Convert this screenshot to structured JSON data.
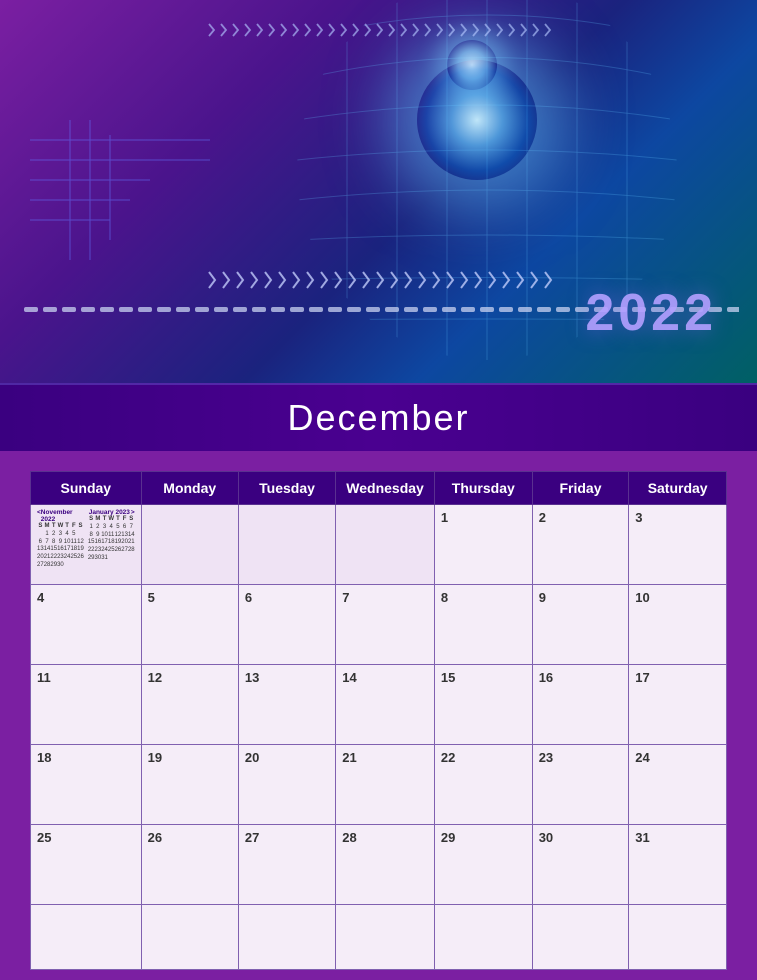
{
  "header": {
    "year": "2022",
    "month": "December",
    "background": {
      "leftColor": "#7b1fa2",
      "rightColor": "#006064"
    }
  },
  "calendar": {
    "days": [
      "Sunday",
      "Monday",
      "Tuesday",
      "Wednesday",
      "Thursday",
      "Friday",
      "Saturday"
    ],
    "weeks": [
      [
        null,
        null,
        null,
        null,
        "1",
        "2",
        "3"
      ],
      [
        "4",
        "5",
        "6",
        "7",
        "8",
        "9",
        "10"
      ],
      [
        "11",
        "12",
        "13",
        "14",
        "15",
        "16",
        "17"
      ],
      [
        "18",
        "19",
        "20",
        "21",
        "22",
        "23",
        "24"
      ],
      [
        "25",
        "26",
        "27",
        "28",
        "29",
        "30",
        "31"
      ],
      [
        null,
        null,
        null,
        null,
        null,
        null,
        null
      ]
    ],
    "mini_calendars": {
      "nov": {
        "title": "November 2022",
        "nav_prev": "<",
        "headers": [
          "S",
          "M",
          "T",
          "W",
          "T",
          "F",
          "S"
        ],
        "days": [
          "",
          "1",
          "2",
          "3",
          "4",
          "5",
          "",
          "6",
          "7",
          "8",
          "9",
          "10",
          "11",
          "12",
          "13",
          "14",
          "15",
          "16",
          "17",
          "18",
          "19",
          "20",
          "21",
          "22",
          "23",
          "24",
          "25",
          "26",
          "27",
          "28",
          "29",
          "30",
          ""
        ]
      },
      "jan": {
        "title": "January 2023",
        "nav_next": ">",
        "headers": [
          "S",
          "M",
          "T",
          "W",
          "T",
          "F",
          "S"
        ],
        "days": [
          "1",
          "2",
          "3",
          "4",
          "5",
          "6",
          "7",
          "8",
          "9",
          "10",
          "11",
          "12",
          "13",
          "14",
          "15",
          "16",
          "17",
          "18",
          "19",
          "20",
          "21",
          "22",
          "23",
          "24",
          "25",
          "26",
          "27",
          "28",
          "29",
          "30",
          "31",
          ""
        ]
      }
    }
  },
  "chevron_count_top": 30,
  "chevron_count_mid": 25,
  "dash_count": 35
}
